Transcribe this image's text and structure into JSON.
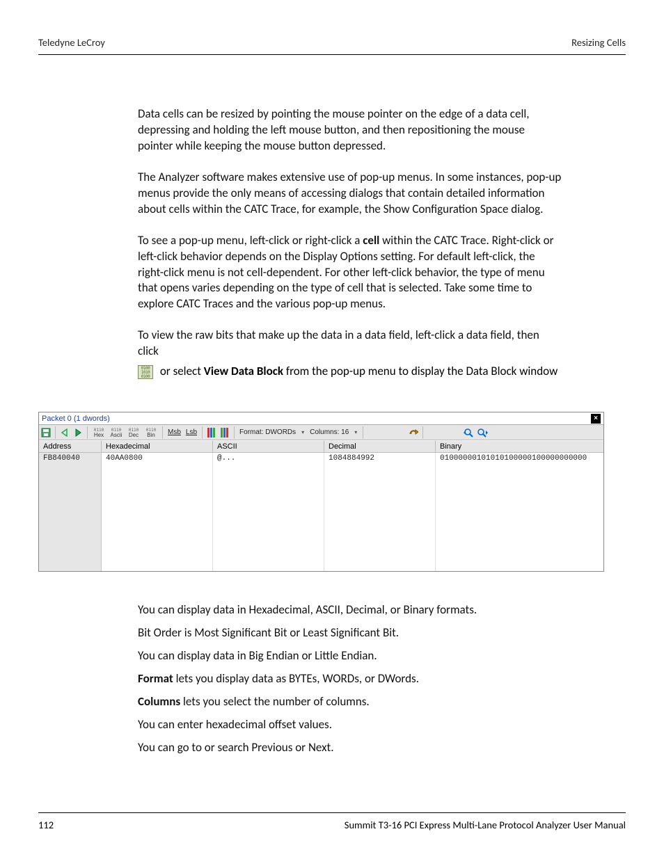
{
  "header": {
    "left": "Teledyne LeCroy",
    "right": "Resizing Cells"
  },
  "footer": {
    "page": "112",
    "manual": "Summit T3-16 PCI Express Multi-Lane Protocol Analyzer User Manual"
  },
  "body": {
    "p1": "Data cells can be resized by pointing the mouse pointer on the edge of a data cell, depressing and holding the left mouse button, and then repositioning the mouse pointer while keeping the mouse button depressed.",
    "p2": "The Analyzer software makes extensive use of pop-up menus. In some instances, pop-up menus provide the only means of accessing dialogs that contain detailed information about cells within the CATC Trace, for example, the Show Configuration Space dialog.",
    "p3_a": "To see a pop-up menu, left-click or right-click a ",
    "p3_bold": "cell",
    "p3_b": " within the CATC Trace. Right-click or left-click behavior depends on the Display Options setting. For default left-click, the right-click menu is not cell-dependent. For other left-click behavior, the type of menu that opens varies depending on the type of cell that is selected. Take some time to explore CATC Traces and the various pop-up menus.",
    "p4": "To view the raw bits that make up the data in a data field, left-click a data field, then click",
    "p5_a": " or select ",
    "p5_bold": "View Data Block",
    "p5_b": " from the pop-up menu to display the Data Block window",
    "after1": "You can display data in Hexadecimal, ASCII, Decimal, or Binary formats.",
    "after2": "Bit Order is Most Significant Bit or Least Significant Bit.",
    "after3": "You can display data in Big Endian or Little Endian.",
    "after4_bold": "Format",
    "after4_rest": " lets you display data as BYTEs, WORDs, or DWords.",
    "after5_bold": "Columns",
    "after5_rest": " lets you select the number of columns.",
    "after6": "You can enter hexadecimal offset values.",
    "after7": "You can go to or search Previous or Next."
  },
  "screenshot": {
    "title": "Packet 0 (1 dwords)",
    "toolbar": {
      "hex": "Hex",
      "ascii": "Ascii",
      "dec": "Dec",
      "bin": "Bin",
      "msb": "Msb",
      "lsb": "Lsb",
      "format_label": "Format: DWORDs",
      "columns_label": "Columns: 16"
    },
    "headers": {
      "addr": "Address",
      "hex": "Hexadecimal",
      "ascii": "ASCII",
      "dec": "Decimal",
      "bin": "Binary"
    },
    "row": {
      "addr": "FB840040",
      "hex": "40AA0800",
      "ascii": "@...",
      "dec": "1084884992",
      "bin": "01000000101010100000100000000000"
    }
  }
}
